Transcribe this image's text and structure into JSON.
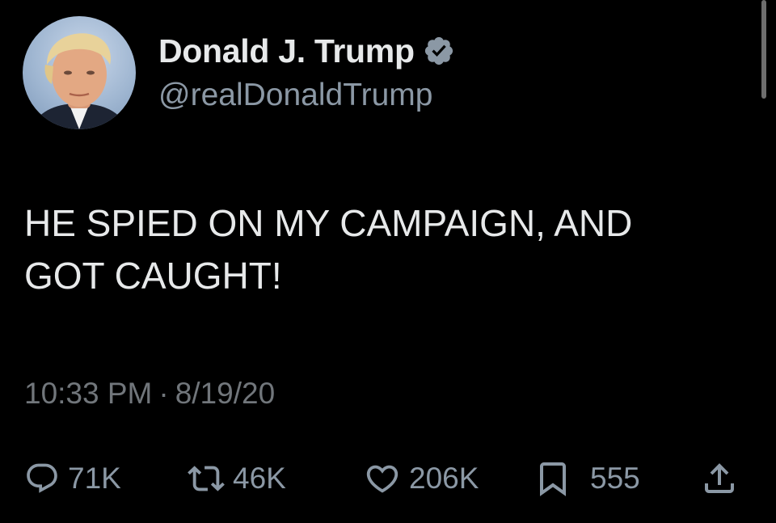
{
  "author": {
    "display_name": "Donald J. Trump",
    "handle": "@realDonaldTrump",
    "verified": true,
    "avatar_icon": "profile-photo"
  },
  "tweet": {
    "text_lines": [
      "HE SPIED ON MY CAMPAIGN, AND",
      "GOT CAUGHT!"
    ],
    "time": "10:33 PM",
    "separator": "·",
    "date": "8/19/20"
  },
  "actions": {
    "reply": {
      "icon": "reply-icon",
      "count": "71K"
    },
    "retweet": {
      "icon": "retweet-icon",
      "count": "46K"
    },
    "like": {
      "icon": "heart-icon",
      "count": "206K"
    },
    "bookmark": {
      "icon": "bookmark-icon",
      "count": "555"
    },
    "share": {
      "icon": "share-icon"
    }
  },
  "colors": {
    "background": "#000000",
    "text_primary": "#e7e9ea",
    "text_secondary": "#8b98a5",
    "verified_badge": "#8b98a5"
  }
}
